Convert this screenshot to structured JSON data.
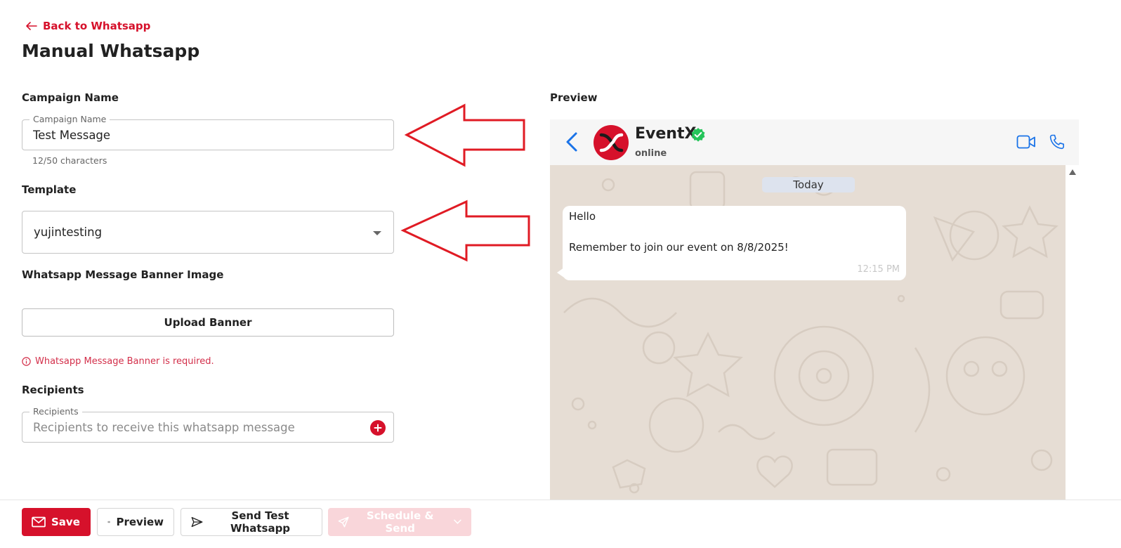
{
  "back_link": {
    "label": "Back to Whatsapp"
  },
  "page_title": "Manual Whatsapp",
  "form": {
    "campaign_name": {
      "section_label": "Campaign Name",
      "legend": "Campaign Name",
      "value": "Test Message",
      "helper": "12/50 characters"
    },
    "template": {
      "section_label": "Template",
      "value": "yujintesting"
    },
    "banner": {
      "section_label": "Whatsapp Message Banner Image",
      "upload_label": "Upload Banner",
      "error": "Whatsapp Message Banner is required."
    },
    "recipients": {
      "section_label": "Recipients",
      "legend": "Recipients",
      "placeholder": "Recipients to receive this whatsapp message"
    }
  },
  "preview": {
    "label": "Preview",
    "contact_name": "EventX",
    "contact_status": "online",
    "date_pill": "Today",
    "message": {
      "line1": "Hello",
      "line2": "Remember to join our event on 8/8/2025!",
      "time": "12:15 PM"
    }
  },
  "footer": {
    "save": "Save",
    "preview": "Preview",
    "send_test": "Send Test Whatsapp",
    "schedule_send": "Schedule & Send"
  },
  "colors": {
    "brand_red": "#d6112b",
    "error_red": "#d32f4a",
    "disabled_pink": "#f9d6da",
    "chat_bg": "#e6ddd4",
    "link_blue": "#1a73e8",
    "verified_green": "#25c45a"
  }
}
